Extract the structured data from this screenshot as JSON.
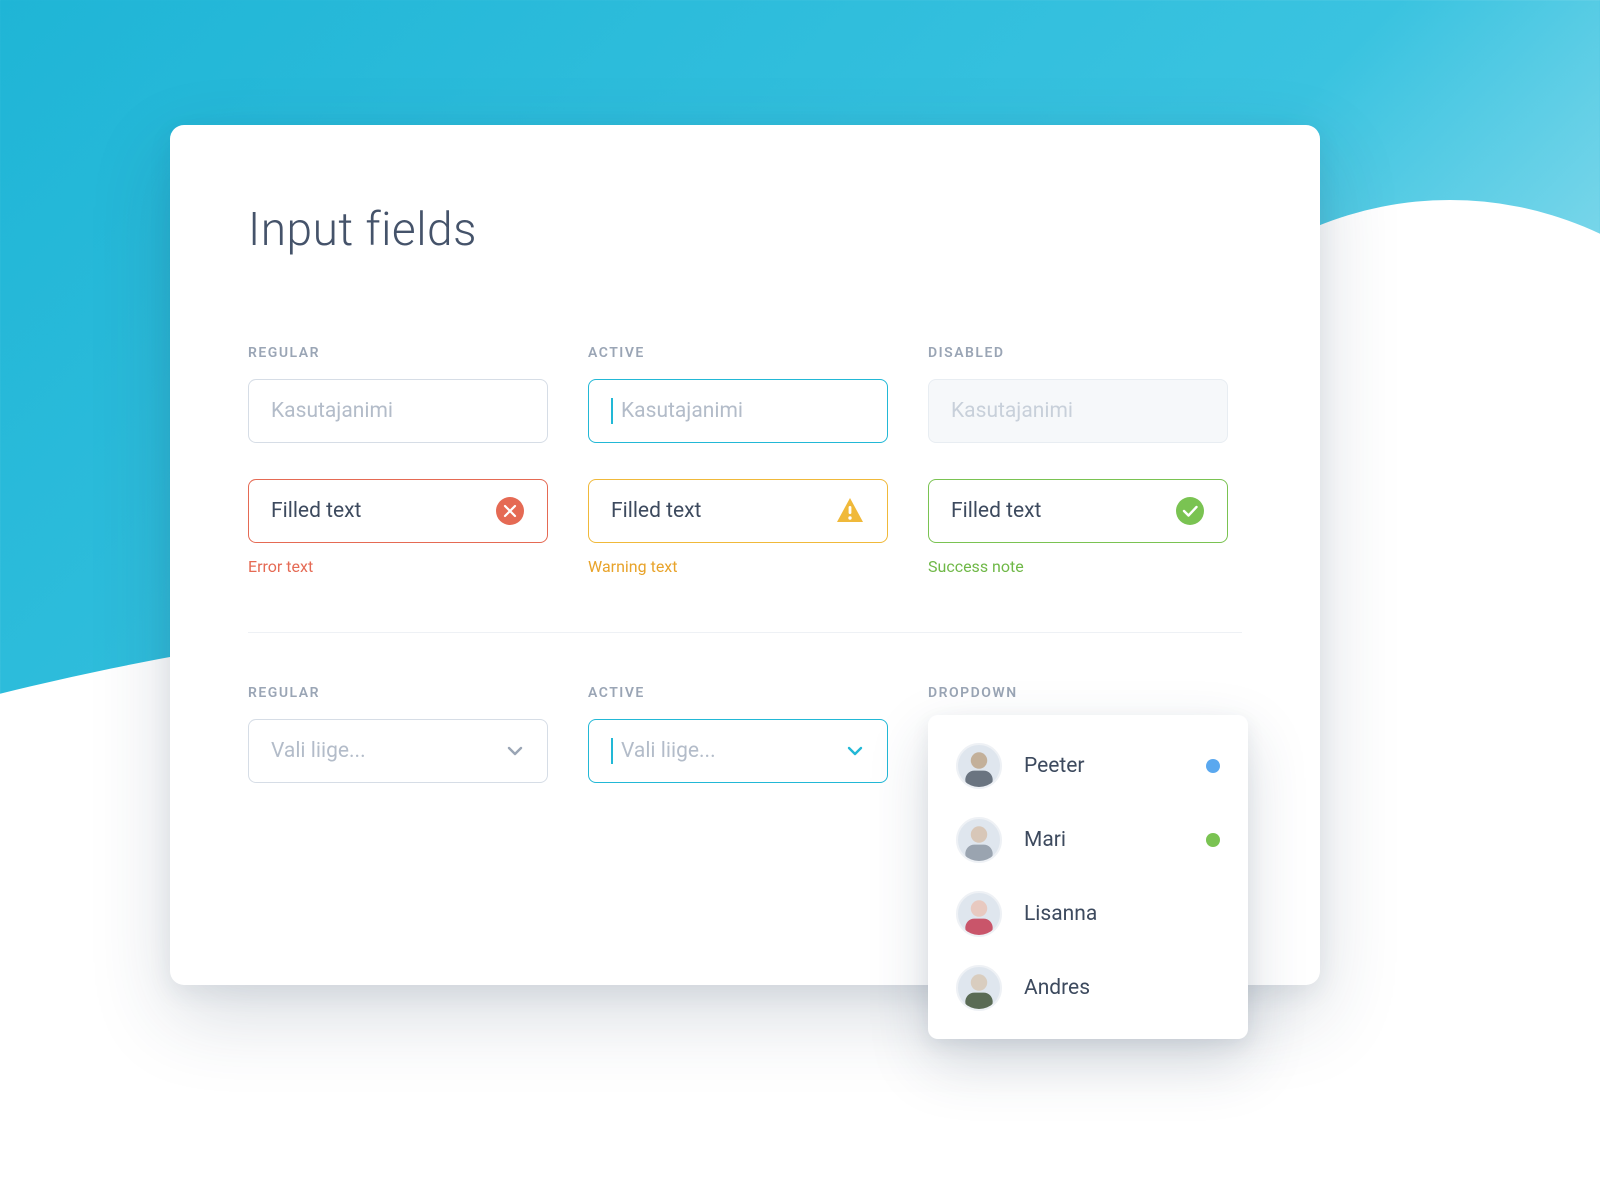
{
  "title": "Input fields",
  "sections": {
    "inputs": {
      "regular": {
        "label": "REGULAR",
        "placeholder": "Kasutajanimi"
      },
      "active": {
        "label": "ACTIVE",
        "placeholder": "Kasutajanimi"
      },
      "disabled": {
        "label": "DISABLED",
        "placeholder": "Kasutajanimi"
      },
      "error": {
        "value": "Filled text",
        "helper": "Error text"
      },
      "warning": {
        "value": "Filled text",
        "helper": "Warning text"
      },
      "success": {
        "value": "Filled text",
        "helper": "Success note"
      }
    },
    "selects": {
      "regular": {
        "label": "REGULAR",
        "placeholder": "Vali liige..."
      },
      "active": {
        "label": "ACTIVE",
        "placeholder": "Vali liige..."
      },
      "dropdown": {
        "label": "DROPDOWN"
      }
    }
  },
  "dropdown_items": [
    {
      "name": "Peeter",
      "status": "blue"
    },
    {
      "name": "Mari",
      "status": "green"
    },
    {
      "name": "Lisanna",
      "status": null
    },
    {
      "name": "Andres",
      "status": null
    }
  ],
  "colors": {
    "accent": "#22b8d6",
    "error": "#e56a54",
    "warning": "#f0b93a",
    "success": "#7ac352"
  }
}
